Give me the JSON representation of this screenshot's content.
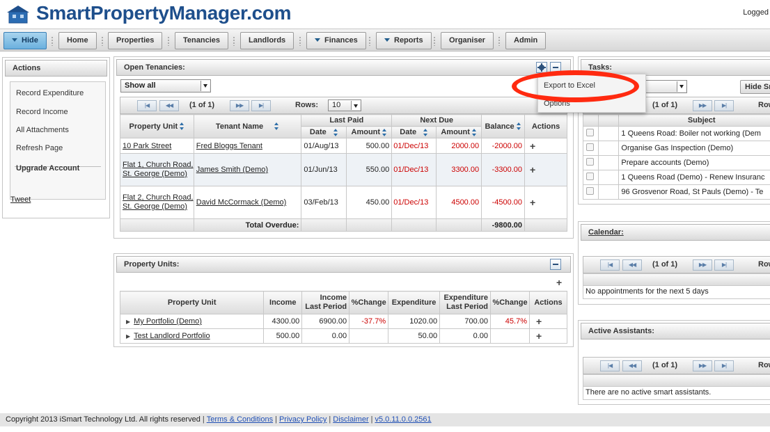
{
  "app": {
    "title": "SmartPropertyManager.com",
    "logged_text": "Logged"
  },
  "nav": {
    "hide": "Hide",
    "home": "Home",
    "properties": "Properties",
    "tenancies": "Tenancies",
    "landlords": "Landlords",
    "finances": "Finances",
    "reports": "Reports",
    "organiser": "Organiser",
    "admin": "Admin"
  },
  "actions": {
    "title": "Actions",
    "items": [
      "Record Expenditure",
      "Record Income",
      "All Attachments",
      "Refresh Page"
    ],
    "upgrade": "Upgrade Account",
    "tweet": "Tweet"
  },
  "open_tenancies": {
    "title": "Open Tenancies:",
    "filter": "Show all",
    "page_info": "(1 of 1)",
    "rows_label": "Rows:",
    "rows_value": "10",
    "headers": {
      "property_unit": "Property Unit",
      "tenant_name": "Tenant Name",
      "last_paid": "Last Paid",
      "next_due": "Next Due",
      "date": "Date",
      "amount": "Amount",
      "balance": "Balance",
      "actions": "Actions"
    },
    "rows": [
      {
        "unit": "10 Park Street",
        "tenant": "Fred Bloggs Tenant",
        "paid_date": "01/Aug/13",
        "paid_amount": "500.00",
        "due_date": "01/Dec/13",
        "due_amount": "2000.00",
        "balance": "-2000.00"
      },
      {
        "unit": "Flat 1, Church Road, St. George (Demo)",
        "tenant": "James Smith (Demo)",
        "paid_date": "01/Jun/13",
        "paid_amount": "550.00",
        "due_date": "01/Dec/13",
        "due_amount": "3300.00",
        "balance": "-3300.00"
      },
      {
        "unit": "Flat 2, Church Road, St. George (Demo)",
        "tenant": "David McCormack (Demo)",
        "paid_date": "03/Feb/13",
        "paid_amount": "450.00",
        "due_date": "01/Dec/13",
        "due_amount": "4500.00",
        "balance": "-4500.00"
      }
    ],
    "total_label": "Total Overdue:",
    "total_value": "-9800.00"
  },
  "options_menu": {
    "export": "Export to Excel",
    "options": "Options"
  },
  "property_units": {
    "title": "Property Units:",
    "headers": {
      "unit": "Property Unit",
      "income": "Income",
      "income_last": "Income Last Period",
      "change": "%Change",
      "expenditure": "Expenditure",
      "expenditure_last": "Expenditure Last Period",
      "change2": "%Change",
      "actions": "Actions"
    },
    "rows": [
      {
        "name": "My Portfolio (Demo)",
        "income": "4300.00",
        "income_last": "6900.00",
        "change": "-37.7%",
        "expenditure": "1020.00",
        "expenditure_last": "700.00",
        "change2": "45.7%"
      },
      {
        "name": "Test Landlord Portfolio",
        "income": "500.00",
        "income_last": "0.00",
        "change": "",
        "expenditure": "50.00",
        "expenditure_last": "0.00",
        "change2": ""
      }
    ]
  },
  "tasks": {
    "title": "Tasks:",
    "hide_btn": "Hide Sm",
    "page_info": "(1 of 1)",
    "rows_label": "Row",
    "subject_header": "Subject",
    "items": [
      "1 Queens Road: Boiler not working (Dem",
      "Organise Gas Inspection (Demo)",
      "Prepare accounts (Demo)",
      "1 Queens Road (Demo) - Renew Insuranc",
      "96 Grosvenor Road, St Pauls (Demo) - Te"
    ]
  },
  "calendar": {
    "title": "Calendar:",
    "page_info": "(1 of 1)",
    "rows_label": "Row",
    "empty": "No appointments for the next 5 days"
  },
  "assistants": {
    "title": "Active Assistants:",
    "page_info": "(1 of 1)",
    "rows_label": "Row",
    "empty": "There are no active smart assistants."
  },
  "footer": {
    "copyright": "Copyright 2013 iSmart Technology Ltd. All rights reserved",
    "terms": "Terms & Conditions",
    "privacy": "Privacy Policy",
    "disclaimer": "Disclaimer",
    "version": "v5.0.11.0.0.2561"
  }
}
